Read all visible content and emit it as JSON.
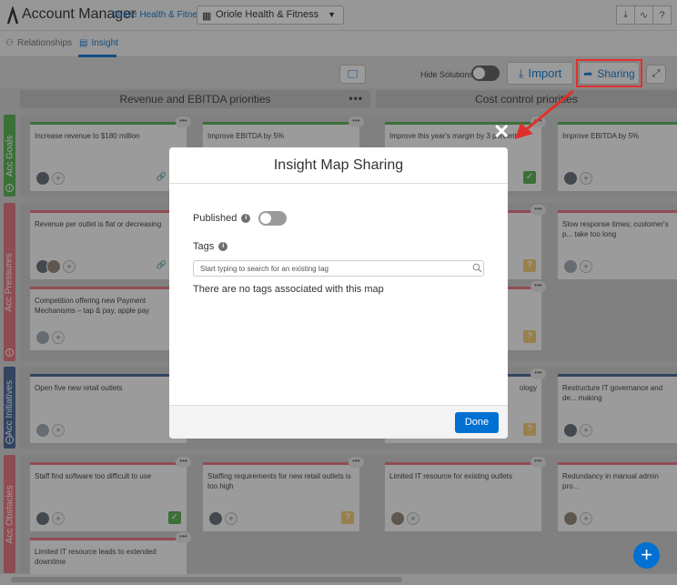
{
  "topbar": {
    "app_title": "Account Manager",
    "account_link": "Oriole Health & Fitness",
    "account_select": "Oriole Health & Fitness"
  },
  "tabs": [
    {
      "label": "Relationships"
    },
    {
      "label": "Insight"
    }
  ],
  "toolbar": {
    "hide_solutions": "Hide Solutions",
    "import_label": "Import",
    "sharing_label": "Sharing"
  },
  "columns": [
    {
      "title": "Revenue and EBITDA priorities"
    },
    {
      "title": "Cost control priorities"
    }
  ],
  "rows": [
    {
      "label": "Acc Goals",
      "color": "#4bab48"
    },
    {
      "label": "Acc Pressures",
      "color": "#e36b75"
    },
    {
      "label": "Acc Initiatives",
      "color": "#3c5b8e"
    },
    {
      "label": "Acc Obstacles",
      "color": "#e36b75"
    }
  ],
  "cards": {
    "goal1": "Increase revenue to $180 million",
    "goal2": "Improve EBITDA by 5%",
    "goal3": "Improve this year's margin by 3 percent",
    "goal4": "Improve EBITDA by 5%",
    "press1": "Revenue per outlet is flat or decreasing",
    "press2": "Slow response times; customer's p... take too long",
    "press3": "Competition offering new Payment Mechanisms – tap & pay, apple pay",
    "init1": "Open five new retail outlets",
    "init2": "ology",
    "init3": "Restructure IT governance and de... making",
    "obs1": "Staff find software too difficult to use",
    "obs2": "Staffing requirements for new retail outlets is too high",
    "obs3": "Limited IT resource for existing outlets",
    "obs4": "Redundancy in manual admin pro...",
    "obs5": "Limited IT resource leads to extended downtime"
  },
  "modal": {
    "title": "Insight Map Sharing",
    "published_label": "Published",
    "published": false,
    "tags_label": "Tags",
    "tag_placeholder": "Start typing to search for an existing tag",
    "no_tags_text": "There are no tags associated with this map",
    "done_label": "Done"
  },
  "accent_color": "#0070d2",
  "highlight_color": "#e0302c"
}
